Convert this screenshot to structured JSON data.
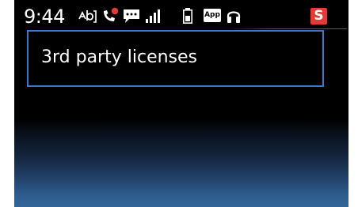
{
  "status_bar": {
    "time": "9:44",
    "app_badge": "App",
    "notification_badge": "S",
    "icons": [
      "sync-icon",
      "missed-call-icon",
      "chat-message-icon",
      "signal-strength-icon",
      "battery-icon",
      "app-icon",
      "headset-icon",
      "s-notification-icon"
    ],
    "colors": {
      "missed_call_dot": "#e53935",
      "s_badge_bg": "#e53935"
    }
  },
  "list": {
    "items": [
      {
        "label": "3rd party licenses",
        "selected": true
      }
    ]
  },
  "colors": {
    "background": "#000000",
    "focus_border": "#3b78c8",
    "text": "#ffffff",
    "bottom_glow": "#34669a"
  }
}
